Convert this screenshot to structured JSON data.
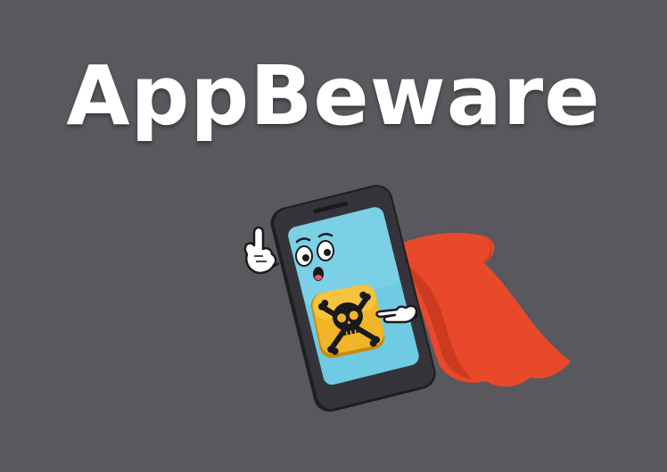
{
  "brand": {
    "title": "AppBeware"
  },
  "illustration": {
    "subject": "superhero-phone-mascot",
    "icons": [
      "phone-icon",
      "cape-icon",
      "skull-crossbones-icon",
      "pointing-hand-icon"
    ],
    "colors": {
      "background": "#58585d",
      "title_text": "#ffffff",
      "phone_body": "#2d2d31",
      "phone_screen": "#6fcbe2",
      "app_icon": "#f2b529",
      "cape": "#e8492a",
      "glove": "#ffffff"
    }
  }
}
